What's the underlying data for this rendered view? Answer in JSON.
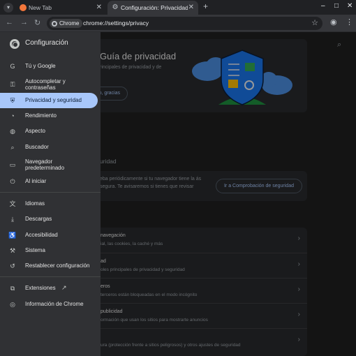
{
  "tabs": [
    {
      "title": "New Tab",
      "close": "✕"
    },
    {
      "title": "Configuración: Privacidad y seguridad",
      "close": "✕"
    }
  ],
  "tabstrip": {
    "new_tab": "+",
    "minimize": "–",
    "maximize": "□",
    "close": "✕"
  },
  "toolbar": {
    "chip_label": "Chrome",
    "url": "chrome://settings/privacy"
  },
  "drawer": {
    "title": "Configuración",
    "items": [
      {
        "label": "Tú y Google",
        "icon": "google-icon"
      },
      {
        "label": "Autocompletar y contraseñas",
        "icon": "key-icon"
      },
      {
        "label": "Privacidad y seguridad",
        "icon": "shield-icon",
        "active": true
      },
      {
        "label": "Rendimiento",
        "icon": "speedometer-icon"
      },
      {
        "label": "Aspecto",
        "icon": "palette-icon"
      },
      {
        "label": "Buscador",
        "icon": "search-icon"
      },
      {
        "label": "Navegador predeterminado",
        "icon": "browser-icon"
      },
      {
        "label": "Al iniciar",
        "icon": "power-icon"
      },
      {
        "label": "Idiomas",
        "icon": "translate-icon"
      },
      {
        "label": "Descargas",
        "icon": "download-icon"
      },
      {
        "label": "Accesibilidad",
        "icon": "accessibility-icon"
      },
      {
        "label": "Sistema",
        "icon": "wrench-icon"
      },
      {
        "label": "Restablecer configuración",
        "icon": "reset-icon"
      },
      {
        "label": "Extensiones",
        "icon": "extension-icon"
      },
      {
        "label": "Información de Chrome",
        "icon": "chrome-icon"
      }
    ]
  },
  "main": {
    "guide": {
      "title": "Guía de privacidad",
      "subtitle": "rincipales de privacidad y de",
      "button": "o, gracias"
    },
    "safety": {
      "heading": "uridad",
      "text": "eba periódicamente si tu navegador tiene la ás segura. Te avisaremos si tienes que revisar",
      "button": "Ir a Comprobación de seguridad"
    },
    "rows": [
      {
        "title": "navegación",
        "subtitle": "ial, las cookies, la caché y más"
      },
      {
        "title": "ad",
        "subtitle": "oles principales de privacidad y seguridad"
      },
      {
        "title": "eros",
        "subtitle": "terceros están bloqueadas en el modo incógnito"
      },
      {
        "title": "publicidad",
        "subtitle": "ormación que usan los sitios para mostrarte anuncios"
      },
      {
        "title": "",
        "subtitle": "ura (protección frente a sitios peligrosos) y otros ajustes de seguridad"
      }
    ]
  },
  "colors": {
    "accent": "#a8c7fa",
    "drawer_bg": "#303134",
    "page_bg": "#1f1f1f"
  }
}
